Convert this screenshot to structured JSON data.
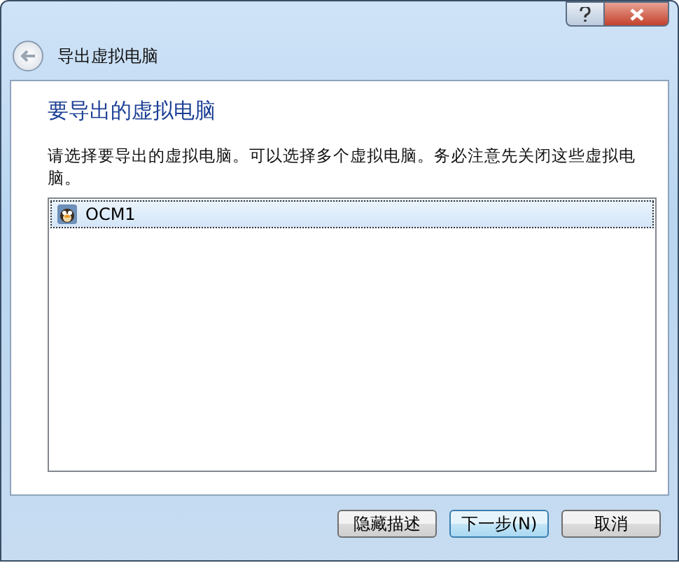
{
  "window": {
    "title": "导出虚拟电脑"
  },
  "page": {
    "heading": "要导出的虚拟电脑",
    "description": "请选择要导出的虚拟电脑。可以选择多个虚拟电脑。务必注意先关闭这些虚拟电脑。"
  },
  "vm_list": [
    {
      "name": "OCM1",
      "selected": true
    }
  ],
  "buttons": [
    {
      "label": "隐藏描述",
      "kind": "normal"
    },
    {
      "label": "下一步(N)",
      "kind": "default"
    },
    {
      "label": "取消",
      "kind": "normal"
    }
  ]
}
